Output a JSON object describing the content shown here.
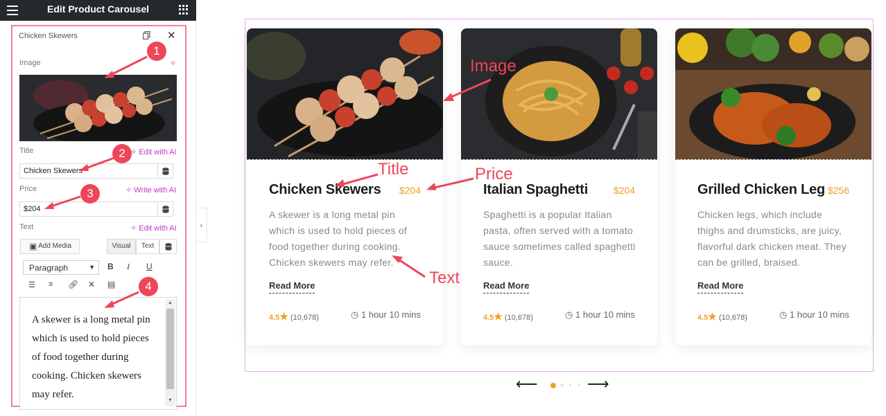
{
  "editor": {
    "title": "Edit Product Carousel",
    "item_label": "Chicken Skewers",
    "image_label": "Image",
    "title_label": "Title",
    "title_ai": "Edit with AI",
    "title_value": "Chicken Skewers",
    "price_label": "Price",
    "price_ai": "Write with AI",
    "price_value": "$204",
    "text_label": "Text",
    "text_ai": "Edit with AI",
    "add_media": "Add Media",
    "tab_visual": "Visual",
    "tab_text": "Text",
    "format_select": "Paragraph",
    "text_value": "A skewer is a long metal pin which is used to hold pieces of food together during cooking. Chicken skewers may refer."
  },
  "badges": [
    "1",
    "2",
    "3",
    "4"
  ],
  "annotations": {
    "image": "Image",
    "title": "Title",
    "price": "Price",
    "text": "Text"
  },
  "cards": [
    {
      "title": "Chicken Skewers",
      "price": "$204",
      "text": "A skewer is a long metal pin which is used to hold pieces of food together during cooking. Chicken skewers may refer.",
      "read_more": "Read More",
      "rating": "4.5",
      "reviews": "(10,678)",
      "time": "1 hour 10 mins"
    },
    {
      "title": "Italian Spaghetti",
      "price": "$204",
      "text": "Spaghetti is a popular Italian pasta, often served with a tomato sauce sometimes called spaghetti sauce.",
      "read_more": "Read More",
      "rating": "4.5",
      "reviews": "(10,678)",
      "time": "1 hour 10 mins"
    },
    {
      "title": "Grilled Chicken Leg",
      "price": "$256",
      "text": "Chicken legs, which include thighs and drumsticks, are juicy, flavorful dark chicken meat. They can be grilled, braised.",
      "read_more": "Read More",
      "rating": "4.5",
      "reviews": "(10,678)",
      "time": "1 hour 10 mins"
    }
  ],
  "colors": {
    "accent": "#f0a020",
    "annotation": "#ee4658",
    "ai": "#c336c3",
    "frame": "#e5a8ee"
  }
}
